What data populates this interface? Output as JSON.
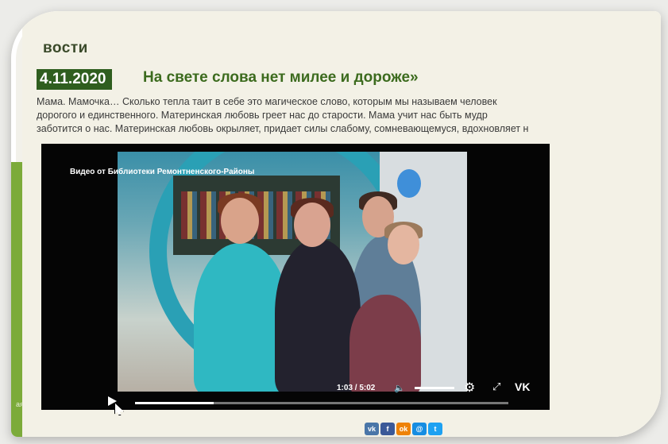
{
  "section": {
    "title": "вости"
  },
  "news": {
    "date": "4.11.2020",
    "headline": "На свете слова нет милее и дороже»",
    "lines": [
      "Мама. Мамочка… Сколько тепла таит в себе это магическое слово, которым мы называем человек",
      "дорогого и единственного. Материнская любовь греет нас до старости. Мама учит нас быть мудр",
      "заботится о нас. Материнская любовь окрыляет, придает силы слабому, сомневающемуся, вдохновляет н"
    ]
  },
  "video": {
    "caption": "Видео от Библиотеки Ремонтненского-Районы",
    "time": "1:03 / 5:02",
    "progress": 0.21,
    "volume": 1.0
  },
  "icons": {
    "play": "play-icon",
    "volume": "volume-icon",
    "settings": "gear-icon",
    "fullscreen": "fullscreen-icon",
    "vk": "vk-icon",
    "vk_label": "VK"
  },
  "share": [
    {
      "name": "vk",
      "label": "vk",
      "color": "#4a76a8"
    },
    {
      "name": "facebook",
      "label": "f",
      "color": "#3b5998"
    },
    {
      "name": "odnoklassniki",
      "label": "ok",
      "color": "#ee8208"
    },
    {
      "name": "moimir",
      "label": "@",
      "color": "#168de2"
    },
    {
      "name": "twitter",
      "label": "t",
      "color": "#1da1f2"
    }
  ],
  "sidebar": {
    "edge_text": "ая"
  },
  "colors": {
    "accent": "#2f5e1f",
    "headline": "#3c6b1e",
    "sidebar": "#7cab3a"
  }
}
